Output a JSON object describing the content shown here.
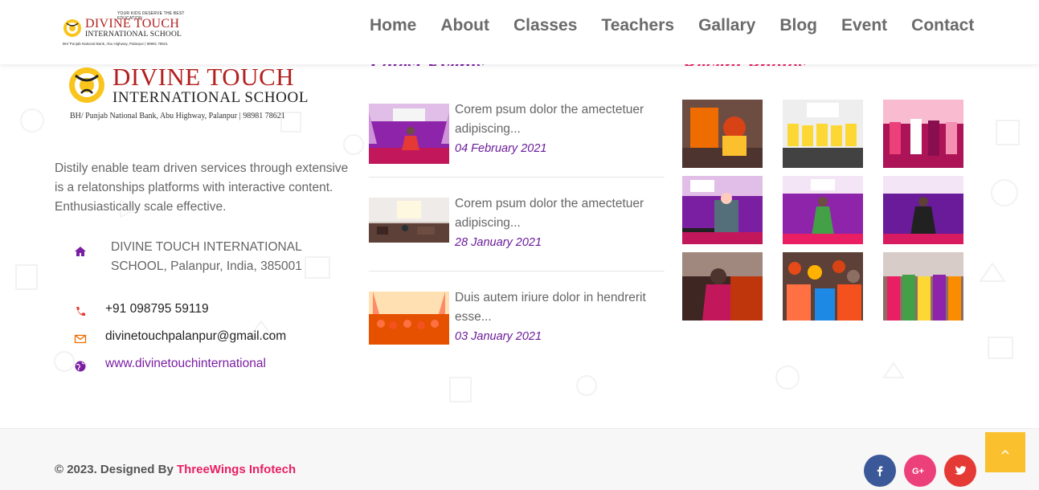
{
  "header": {
    "logo": {
      "tagline": "YOUR KIDS DESERVE THE BEST EDUCATION",
      "name": "DIVINE TOUCH",
      "subname": "INTERNATIONAL SCHOOL",
      "address": "BH/ Punjab National Bank, Abu Highway, Palanpur | 98981 78621"
    },
    "nav": [
      "Home",
      "About",
      "Classes",
      "Teachers",
      "Gallary",
      "Blog",
      "Event",
      "Contact"
    ]
  },
  "sections": {
    "events_title": "Latest Events",
    "photos_title": "Recent Photos"
  },
  "about": {
    "logo_name": "DIVINE TOUCH",
    "logo_subname": "INTERNATIONAL SCHOOL",
    "logo_address": "BH/ Punjab National Bank, Abu Highway, Palanpur | 98981 78621",
    "description": "Distily enable team driven services through extensive is a relatonships platforms with interactive content. Enthusiastically scale effective.",
    "address": "DIVINE TOUCH INTERNATIONAL SCHOOL, Palanpur, India, 385001",
    "phone": "+91 098795 59119",
    "email": "divinetouchpalanpur@gmail.com",
    "website": "www.divinetouchinternational"
  },
  "events": [
    {
      "title": "Corem psum dolor the amectetuer adipiscing...",
      "date": "04 February 2021"
    },
    {
      "title": "Corem psum dolor the amectetuer adipiscing...",
      "date": "28 January 2021"
    },
    {
      "title": "Duis autem iriure dolor in hendrerit esse...",
      "date": "03 January 2021"
    }
  ],
  "gallery_count": 9,
  "footer": {
    "copyright": "© 2023. Designed By ",
    "designer": "ThreeWings Infotech"
  },
  "colors": {
    "primary": "#7b1fa2",
    "accent": "#e91e63",
    "facebook": "#3b5998",
    "googleplus": "#ec407a",
    "twitter": "#e53935",
    "scrolltop": "#fbc02d"
  },
  "icons": {
    "address": "home-icon",
    "phone": "phone-icon",
    "email": "envelope-icon",
    "website": "globe-icon",
    "facebook": "facebook-icon",
    "googleplus": "google-plus-icon",
    "twitter": "twitter-icon",
    "scrolltop": "chevron-up-icon"
  }
}
